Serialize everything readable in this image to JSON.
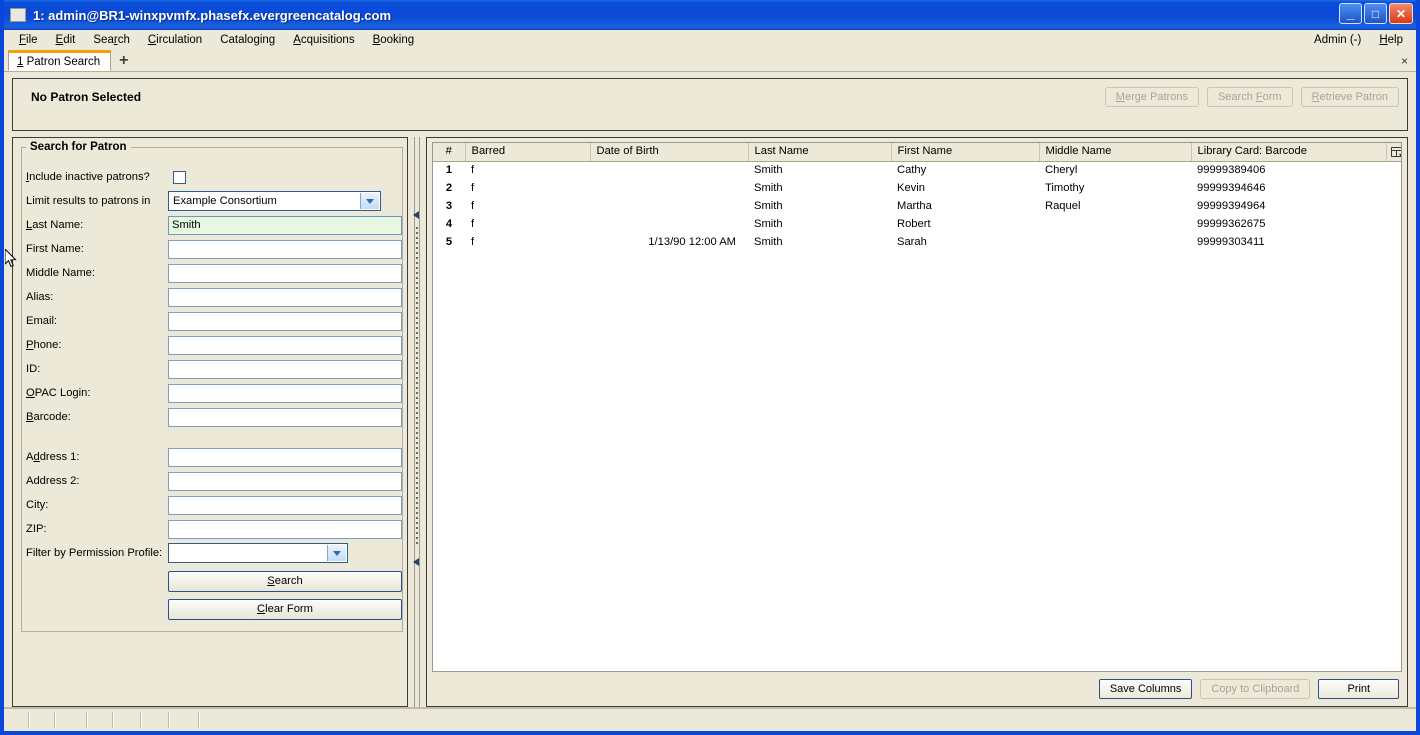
{
  "window": {
    "title": "1: admin@BR1-winxpvmfx.phasefx.evergreencatalog.com",
    "minimize_glyph": "_",
    "maximize_glyph": "□",
    "close_glyph": "✕"
  },
  "menubar": {
    "items": [
      {
        "label": "File",
        "accel": "F"
      },
      {
        "label": "Edit",
        "accel": "E"
      },
      {
        "label": "Search",
        "accel": "r"
      },
      {
        "label": "Circulation",
        "accel": "C"
      },
      {
        "label": "Cataloging",
        "accel": "g"
      },
      {
        "label": "Acquisitions",
        "accel": "A"
      },
      {
        "label": "Booking",
        "accel": "B"
      }
    ],
    "right_items": [
      {
        "label": "Admin (-)"
      },
      {
        "label": "Help",
        "accel": "H"
      }
    ]
  },
  "tabbar": {
    "tabs": [
      {
        "number": "1",
        "label": "Patron Search"
      }
    ],
    "new_tab_glyph": "+",
    "close_glyph": "×"
  },
  "patron_header": {
    "title": "No Patron Selected",
    "buttons": [
      {
        "label": "Merge Patrons",
        "disabled": true
      },
      {
        "label": "Search Form",
        "disabled": true
      },
      {
        "label": "Retrieve Patron",
        "disabled": true
      }
    ]
  },
  "search_form": {
    "legend": "Search for Patron",
    "fields": [
      {
        "label": "Include inactive patrons?",
        "type": "checkbox",
        "checked": false
      },
      {
        "label": "Limit results to patrons in",
        "type": "select",
        "value": "Example Consortium"
      },
      {
        "label": "Last Name:",
        "type": "text",
        "value": "Smith",
        "focused": true
      },
      {
        "label": "First Name:",
        "type": "text",
        "value": ""
      },
      {
        "label": "Middle Name:",
        "type": "text",
        "value": ""
      },
      {
        "label": "Alias:",
        "type": "text",
        "value": ""
      },
      {
        "label": "Email:",
        "type": "text",
        "value": ""
      },
      {
        "label": "Phone:",
        "type": "text",
        "value": ""
      },
      {
        "label": "ID:",
        "type": "text",
        "value": ""
      },
      {
        "label": "OPAC Login:",
        "type": "text",
        "value": ""
      },
      {
        "label": "Barcode:",
        "type": "text",
        "value": ""
      },
      {
        "label": "",
        "type": "gap"
      },
      {
        "label": "Address 1:",
        "type": "text",
        "value": ""
      },
      {
        "label": "Address 2:",
        "type": "text",
        "value": ""
      },
      {
        "label": "City:",
        "type": "text",
        "value": ""
      },
      {
        "label": "ZIP:",
        "type": "text",
        "value": ""
      },
      {
        "label": "Filter by Permission Profile:",
        "type": "select",
        "value": ""
      }
    ],
    "search_button": "Search",
    "clear_button": "Clear Form"
  },
  "results": {
    "columns": [
      "#",
      "Barred",
      "Date of Birth",
      "Last Name",
      "First Name",
      "Middle Name",
      "Library Card: Barcode"
    ],
    "rows": [
      {
        "num": "1",
        "barred": "f",
        "dob": "",
        "last": "Smith",
        "first": "Cathy",
        "middle": "Cheryl",
        "barcode": "99999389406"
      },
      {
        "num": "2",
        "barred": "f",
        "dob": "",
        "last": "Smith",
        "first": "Kevin",
        "middle": "Timothy",
        "barcode": "99999394646"
      },
      {
        "num": "3",
        "barred": "f",
        "dob": "",
        "last": "Smith",
        "first": "Martha",
        "middle": "Raquel",
        "barcode": "99999394964"
      },
      {
        "num": "4",
        "barred": "f",
        "dob": "",
        "last": "Smith",
        "first": "Robert",
        "middle": "",
        "barcode": "99999362675"
      },
      {
        "num": "5",
        "barred": "f",
        "dob": "1/13/90 12:00 AM",
        "last": "Smith",
        "first": "Sarah",
        "middle": "",
        "barcode": "99999303411"
      }
    ],
    "footer_buttons": [
      {
        "label": "Save Columns",
        "disabled": false
      },
      {
        "label": "Copy to Clipboard",
        "disabled": true
      },
      {
        "label": "Print",
        "disabled": false
      }
    ]
  },
  "statusbar": {
    "segment_widths": [
      24,
      26,
      32,
      26,
      28,
      28,
      30
    ]
  },
  "colors": {
    "window_frame": "#0a46d8",
    "titlebar": "#0a4fd8",
    "chrome": "#ece9d8",
    "tab_accent": "#f2a00c",
    "focused_field": "#e6f8e1"
  }
}
